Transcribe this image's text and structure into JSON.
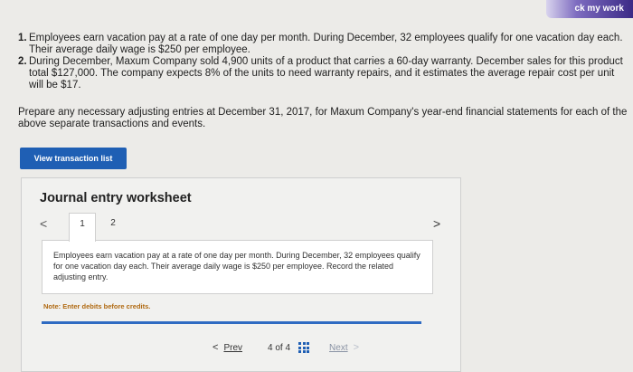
{
  "header": {
    "check_label": "ck my work"
  },
  "questions": [
    {
      "num": "1.",
      "text": "Employees earn vacation pay at a rate of one day per month. During December, 32 employees qualify for one vacation day each. Their average daily wage is $250 per employee."
    },
    {
      "num": "2.",
      "text": "During December, Maxum Company sold 4,900 units of a product that carries a 60-day warranty. December sales for this product total $127,000. The company expects 8% of the units to need warranty repairs, and it estimates the average repair cost per unit will be $17."
    }
  ],
  "prepare_text": "Prepare any necessary adjusting entries at December 31, 2017, for Maxum Company's year-end financial statements for each of the above separate transactions and events.",
  "view_button": "View transaction list",
  "worksheet": {
    "title": "Journal entry worksheet",
    "prev_arrow": "<",
    "next_arrow": ">",
    "tabs": [
      "1",
      "2"
    ],
    "instruction": "Employees earn vacation pay at a rate of one day per month. During December, 32 employees qualify for one vacation day each. Their average daily wage is $250 per employee. Record the related adjusting entry.",
    "note": "Note: Enter debits before credits."
  },
  "pager": {
    "prev_chevron": "<",
    "prev_label": "Prev",
    "page": "4 of 4",
    "next_label": "Next",
    "next_chevron": ">"
  }
}
